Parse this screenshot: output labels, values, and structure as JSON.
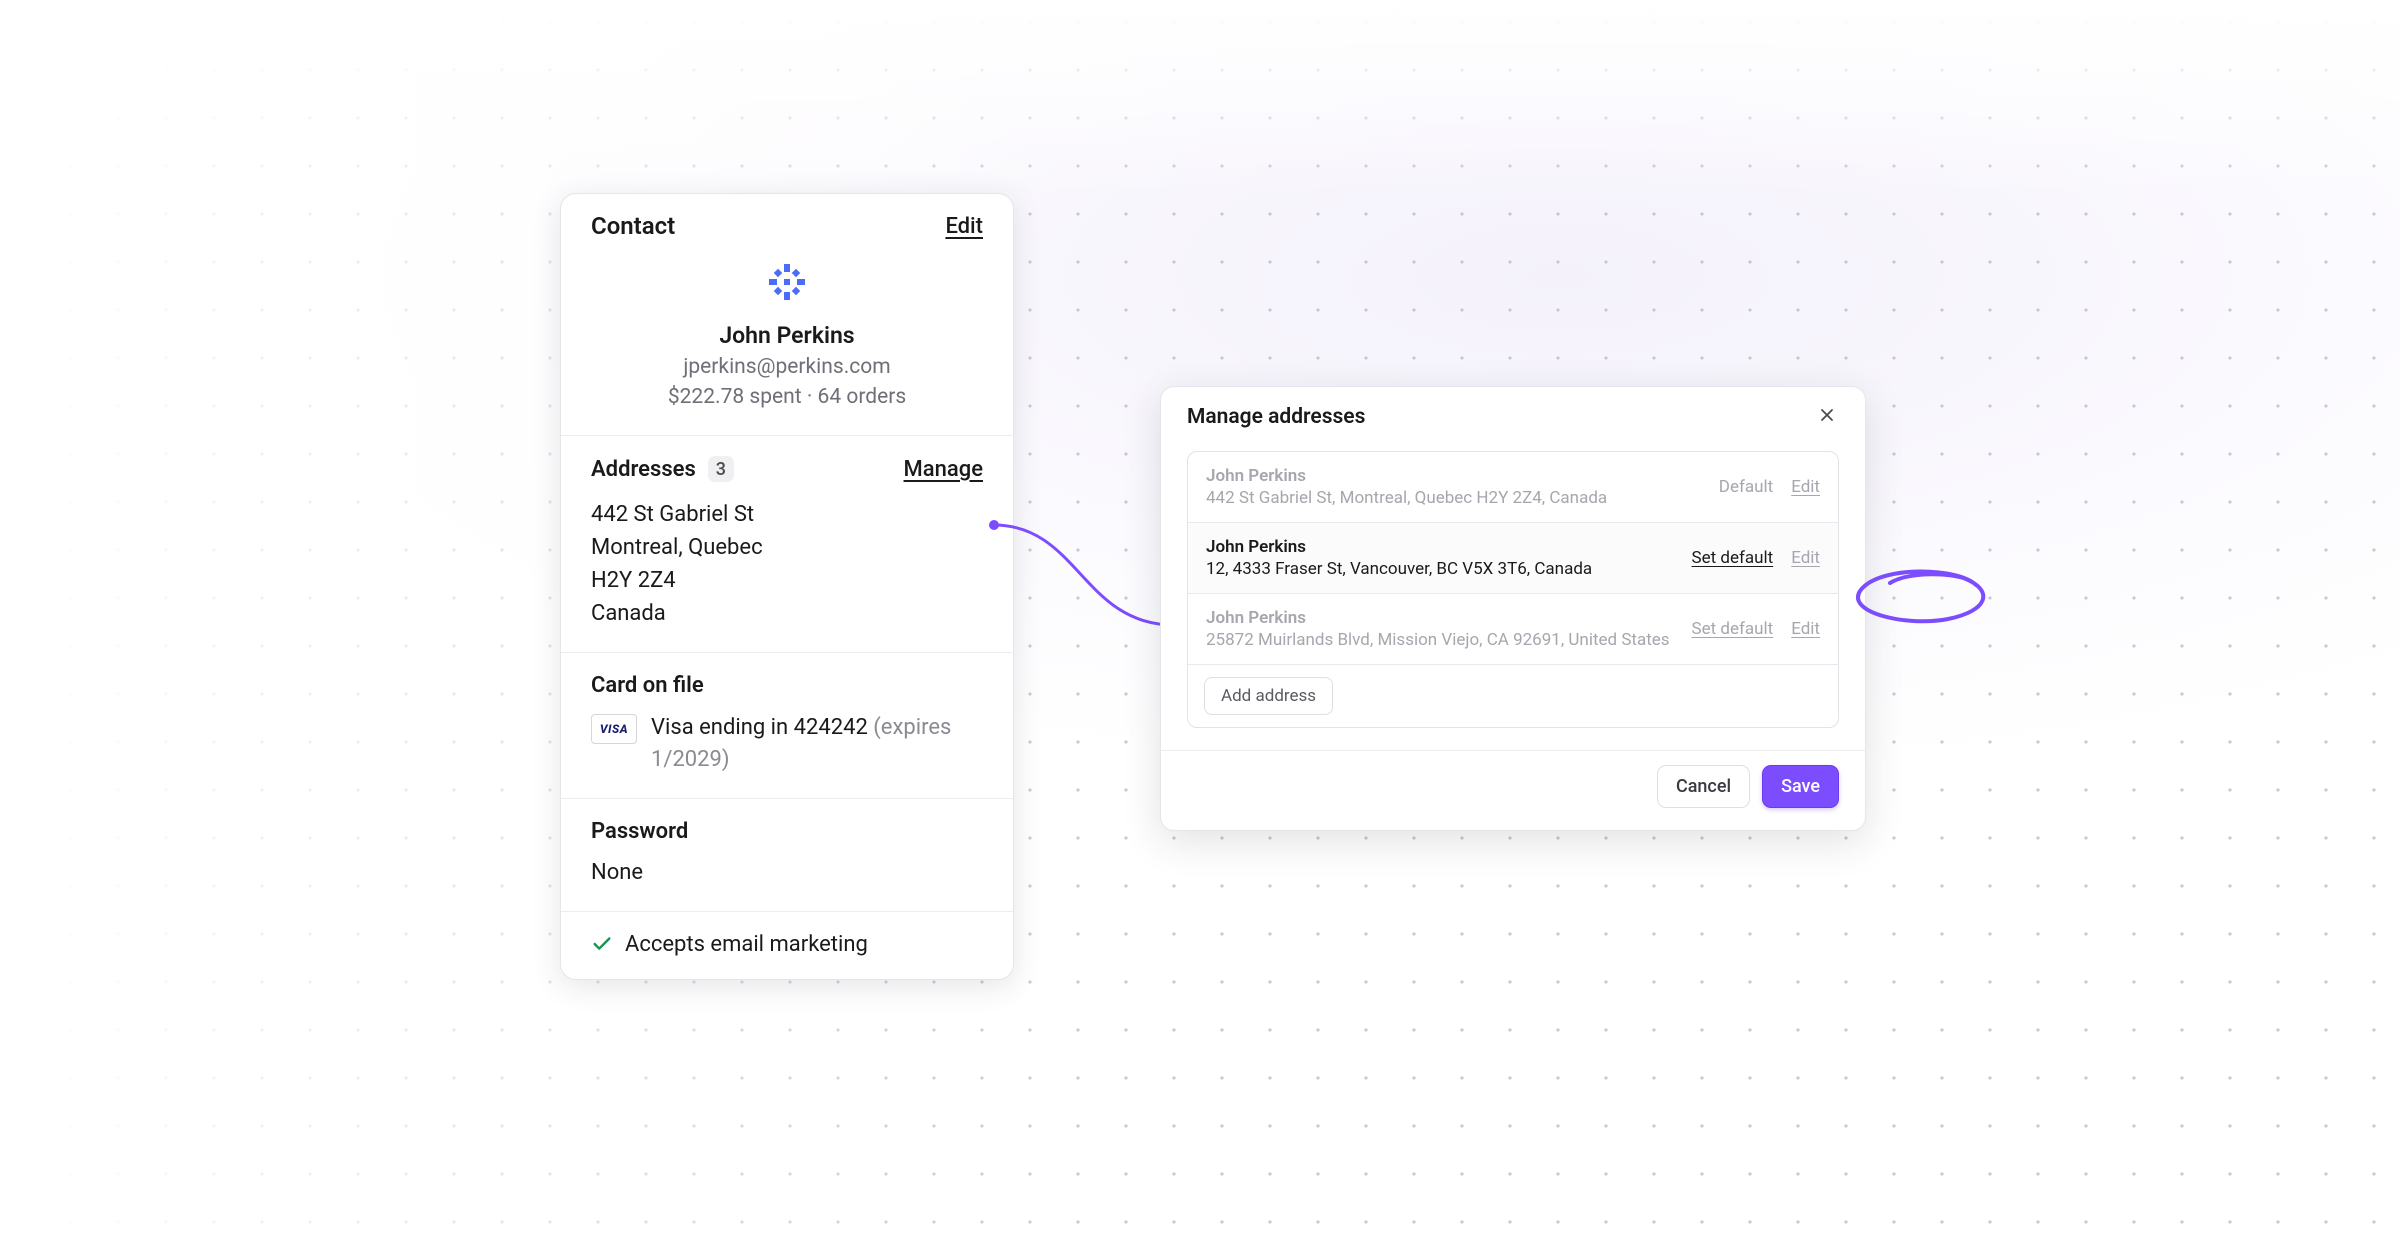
{
  "contact": {
    "header_title": "Contact",
    "edit_label": "Edit",
    "name": "John Perkins",
    "email": "jperkins@perkins.com",
    "spend_orders": "$222.78 spent · 64 orders",
    "addresses_label": "Addresses",
    "addresses_count": "3",
    "manage_label": "Manage",
    "address_line1": "442 St Gabriel St",
    "address_line2": "Montreal, Quebec",
    "address_line3": "H2Y 2Z4",
    "address_line4": "Canada",
    "card_label": "Card on file",
    "card_brand": "VISA",
    "card_text": "Visa ending in 424242",
    "card_expiry": "(expires 1/2029)",
    "password_label": "Password",
    "password_value": "None",
    "marketing_text": "Accepts email marketing"
  },
  "modal": {
    "title": "Manage addresses",
    "add_address_label": "Add address",
    "cancel_label": "Cancel",
    "save_label": "Save",
    "default_label": "Default",
    "set_default_label": "Set default",
    "edit_label": "Edit",
    "rows": [
      {
        "name": "John Perkins",
        "line": "442 St Gabriel St, Montreal, Quebec H2Y 2Z4, Canada"
      },
      {
        "name": "John Perkins",
        "line": "12, 4333 Fraser St, Vancouver, BC V5X 3T6, Canada"
      },
      {
        "name": "John Perkins",
        "line": "25872 Muirlands Blvd, Mission Viejo, CA 92691, United States"
      }
    ]
  },
  "colors": {
    "accent": "#7c4dff",
    "check": "#189253"
  }
}
